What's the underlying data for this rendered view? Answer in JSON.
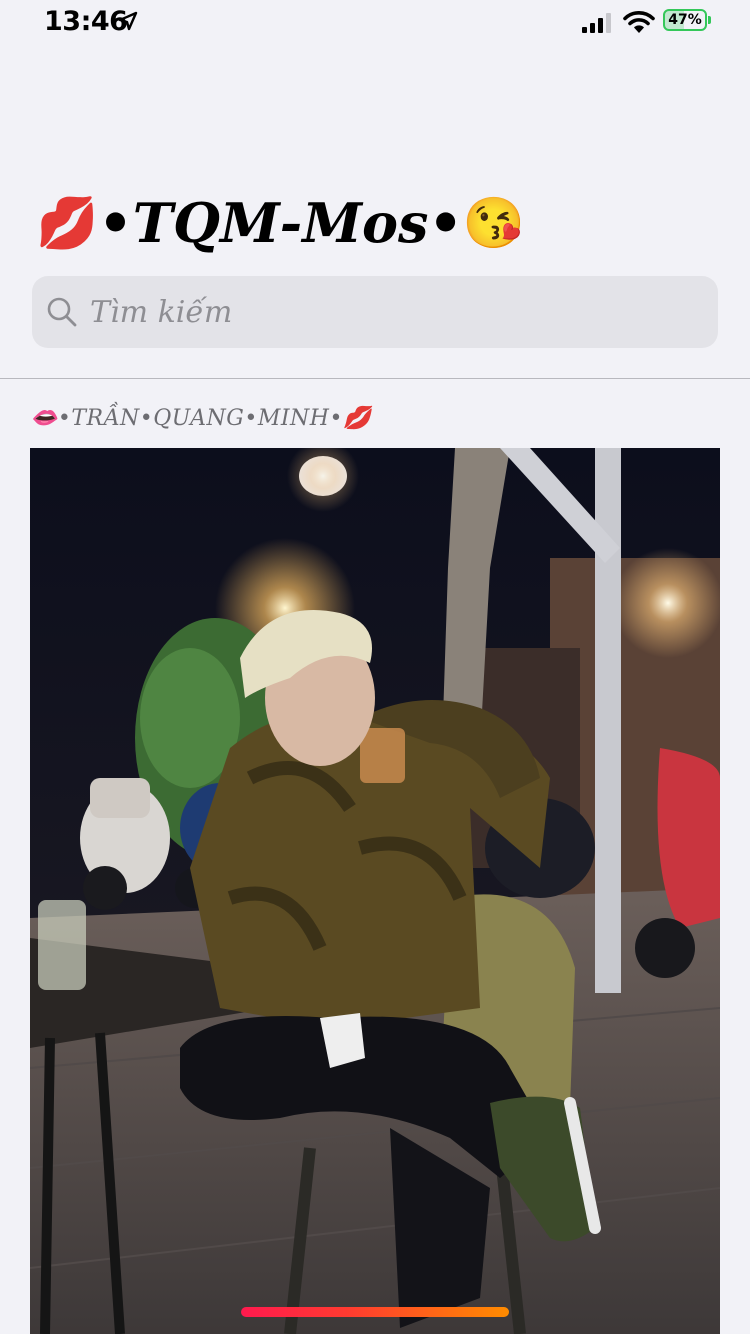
{
  "status_bar": {
    "time": "13:46",
    "battery_percent": "47%",
    "battery_level": 0.47,
    "signal_bars": 3,
    "icons": [
      "location-arrow-icon",
      "cellular-signal-icon",
      "wifi-icon",
      "battery-icon"
    ]
  },
  "header": {
    "title_text": "•TQM-Mos•",
    "title_left_emoji": "💋",
    "title_right_emoji": "😘"
  },
  "search": {
    "placeholder": "Tìm kiếm",
    "value": ""
  },
  "section": {
    "header_text": "•TRẦN•QUANG•MINH•",
    "left_emoji": "👄",
    "right_emoji": "💋"
  },
  "photo": {
    "subject": "photo"
  },
  "colors": {
    "background": "#f2f2f7",
    "search_bg": "#e3e3e8",
    "battery_green": "#34c759",
    "scroll_indicator_start": "#ff1a4e",
    "scroll_indicator_end": "#ff8c00"
  }
}
